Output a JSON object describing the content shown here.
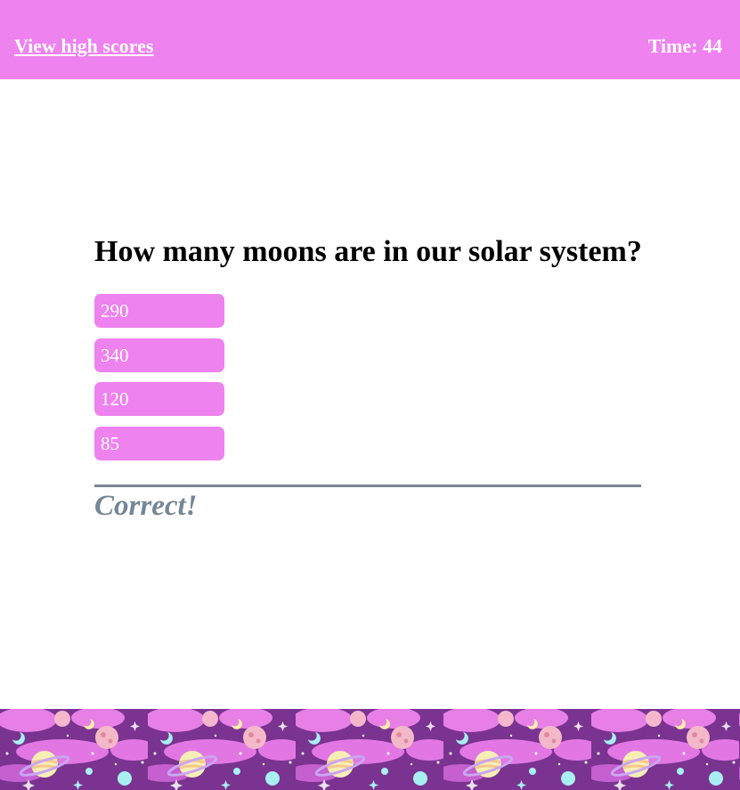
{
  "header": {
    "high_scores_label": "View high scores",
    "timer_label": "Time:",
    "timer_value": "44"
  },
  "quiz": {
    "question": "How many moons are in our solar system?",
    "choices": [
      "290",
      "340",
      "120",
      "85"
    ],
    "feedback": "Correct!"
  },
  "footer": {
    "pattern_icon": "space-planets-pattern"
  },
  "colors": {
    "accent": "#ee82ee",
    "feedback": "#738796",
    "divider": "#7b8790",
    "footer_bg": "#7a3390"
  }
}
